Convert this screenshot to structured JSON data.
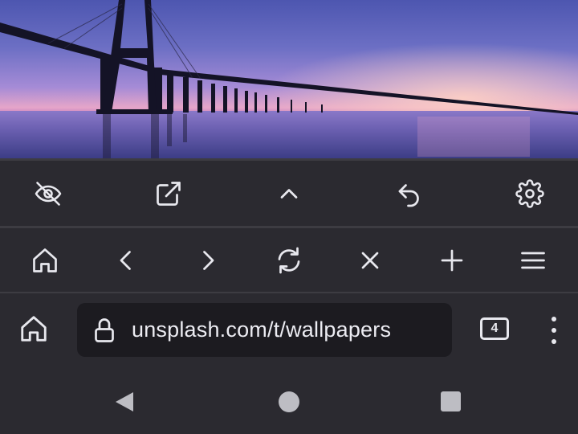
{
  "background_photo": {
    "description_icon": "bridge-sunset-wallpaper",
    "colors": {
      "sky_top": "#4d56b0",
      "horizon": "#e6a5c9",
      "water": "#3b3f86"
    }
  },
  "toolbar_top": {
    "items": [
      {
        "name": "hide-toolbar-button",
        "icon": "eye-off-icon"
      },
      {
        "name": "open-external-button",
        "icon": "external-link-icon"
      },
      {
        "name": "scroll-up-button",
        "icon": "chevron-up-icon"
      },
      {
        "name": "undo-button",
        "icon": "undo-icon"
      },
      {
        "name": "settings-button",
        "icon": "gear-icon"
      }
    ]
  },
  "toolbar_nav": {
    "items": [
      {
        "name": "home-button",
        "icon": "home-icon"
      },
      {
        "name": "back-button",
        "icon": "chevron-left-icon"
      },
      {
        "name": "forward-button",
        "icon": "chevron-right-icon"
      },
      {
        "name": "reload-button",
        "icon": "refresh-icon"
      },
      {
        "name": "stop-button",
        "icon": "close-icon"
      },
      {
        "name": "new-tab-button",
        "icon": "plus-icon"
      },
      {
        "name": "menu-button",
        "icon": "hamburger-icon"
      }
    ]
  },
  "address_bar": {
    "url": "unsplash.com/t/wallpapers",
    "tab_count": "4"
  },
  "system_nav": {
    "back": "triangle-back-icon",
    "home": "circle-home-icon",
    "recents": "square-recents-icon"
  },
  "colors": {
    "toolbar_bg": "#2b2a30",
    "url_field_bg": "#1c1b20",
    "icon": "#e8e8ee"
  }
}
